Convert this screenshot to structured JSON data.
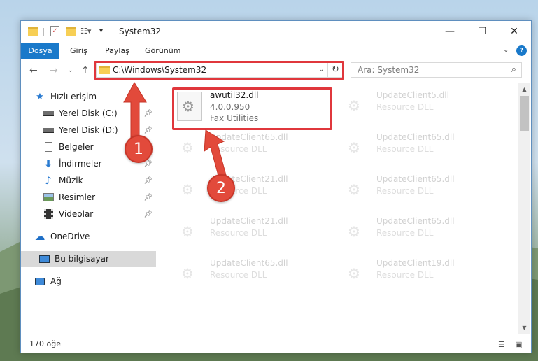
{
  "window": {
    "title": "System32",
    "controls": {
      "minimize": "—",
      "maximize": "☐",
      "close": "✕"
    }
  },
  "ribbon": {
    "tabs": [
      "Dosya",
      "Giriş",
      "Paylaş",
      "Görünüm"
    ]
  },
  "address": {
    "path": "C:\\Windows\\System32",
    "search_placeholder": "Ara: System32"
  },
  "navpane": {
    "items": [
      {
        "label": "Hızlı erişim",
        "icon": "star-icon",
        "pinned": false
      },
      {
        "label": "Yerel Disk (C:)",
        "icon": "drive-icon",
        "pinned": true
      },
      {
        "label": "Yerel Disk (D:)",
        "icon": "drive-icon",
        "pinned": true
      },
      {
        "label": "Belgeler",
        "icon": "documents-icon",
        "pinned": true
      },
      {
        "label": "İndirmeler",
        "icon": "download-icon",
        "pinned": true
      },
      {
        "label": "Müzik",
        "icon": "music-icon",
        "pinned": true
      },
      {
        "label": "Resimler",
        "icon": "pictures-icon",
        "pinned": true
      },
      {
        "label": "Videolar",
        "icon": "videos-icon",
        "pinned": true
      },
      {
        "label": "OneDrive",
        "icon": "cloud-icon",
        "pinned": false
      },
      {
        "label": "Bu bilgisayar",
        "icon": "computer-icon",
        "pinned": false,
        "selected": true
      },
      {
        "label": "Ağ",
        "icon": "network-icon",
        "pinned": false
      }
    ]
  },
  "files": [
    {
      "name": "awutil32.dll",
      "line1": "4.0.0.950",
      "line2": "Fax Utilities",
      "highlighted": true
    },
    {
      "name": "UpdateClient5.dll",
      "line1": "Resource DLL",
      "line2": "",
      "highlighted": false
    },
    {
      "name": "UpdateClient65.dll",
      "line1": "Resource DLL",
      "line2": "",
      "highlighted": false
    },
    {
      "name": "UpdateClient65.dll",
      "line1": "Resource DLL",
      "line2": "",
      "highlighted": false
    },
    {
      "name": "UpdateClient21.dll",
      "line1": "Resource DLL",
      "line2": "",
      "highlighted": false
    },
    {
      "name": "UpdateClient65.dll",
      "line1": "Resource DLL",
      "line2": "",
      "highlighted": false
    },
    {
      "name": "UpdateClient21.dll",
      "line1": "Resource DLL",
      "line2": "",
      "highlighted": false
    },
    {
      "name": "UpdateClient65.dll",
      "line1": "Resource DLL",
      "line2": "",
      "highlighted": false
    },
    {
      "name": "UpdateClient65.dll",
      "line1": "Resource DLL",
      "line2": "",
      "highlighted": false
    },
    {
      "name": "UpdateClient19.dll",
      "line1": "Resource DLL",
      "line2": "",
      "highlighted": false
    }
  ],
  "status": {
    "count_text": "170 öğe"
  },
  "callouts": {
    "step1": "1",
    "step2": "2"
  },
  "colors": {
    "accent": "#1979ca",
    "highlight": "#e0373c",
    "badge": "#e24a3b"
  }
}
